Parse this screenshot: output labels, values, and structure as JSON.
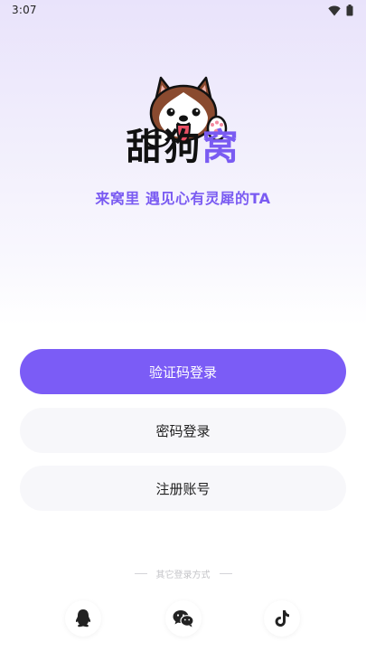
{
  "status_bar": {
    "time": "3:07",
    "icons": [
      "wifi-icon",
      "battery-icon"
    ]
  },
  "logo": {
    "name_part1": "甜狗",
    "name_part2": "窝",
    "mascot": "husky-mascot"
  },
  "slogan": "来窝里  遇见心有灵犀的TA",
  "buttons": {
    "code_login": "验证码登录",
    "password_login": "密码登录",
    "register": "注册账号"
  },
  "other_login": {
    "label": "其它登录方式",
    "providers": [
      "qq-icon",
      "wechat-icon",
      "tiktok-icon"
    ]
  },
  "colors": {
    "accent": "#7b5cf6",
    "secondary_button": "#f7f7fa",
    "background_top": "#e9e3fb"
  }
}
